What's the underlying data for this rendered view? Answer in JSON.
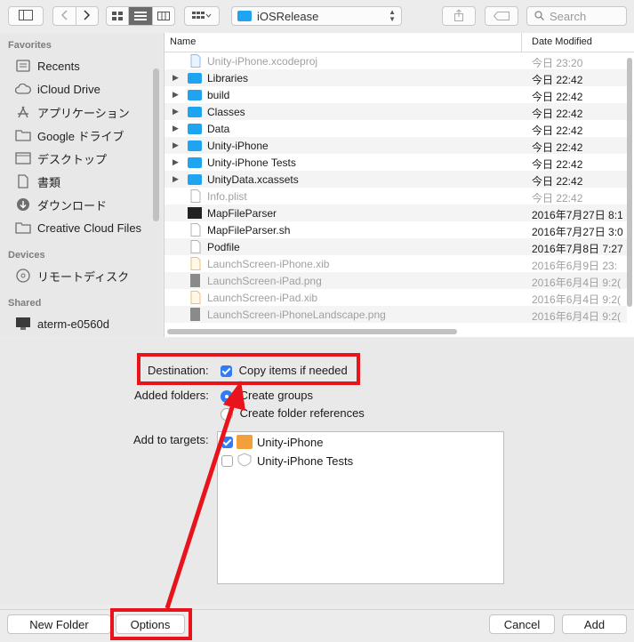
{
  "toolbar": {
    "location": "iOSRelease",
    "search_placeholder": "Search",
    "icons": [
      "sidebar-toggle-icon",
      "back-icon",
      "forward-icon",
      "icon-view-icon",
      "list-view-icon",
      "column-view-icon",
      "group-icon",
      "share-icon",
      "tag-icon",
      "search-icon"
    ]
  },
  "sidebar": {
    "favorites_header": "Favorites",
    "favorites": [
      {
        "label": "Recents",
        "icon": "recents-icon"
      },
      {
        "label": "iCloud Drive",
        "icon": "cloud-icon"
      },
      {
        "label": "アプリケーション",
        "icon": "applications-icon"
      },
      {
        "label": "Google ドライブ",
        "icon": "folder-icon"
      },
      {
        "label": "デスクトップ",
        "icon": "desktop-icon"
      },
      {
        "label": "書類",
        "icon": "document-icon"
      },
      {
        "label": "ダウンロード",
        "icon": "download-icon"
      },
      {
        "label": "Creative Cloud Files",
        "icon": "folder-icon"
      }
    ],
    "devices_header": "Devices",
    "devices": [
      {
        "label": "リモートディスク",
        "icon": "disc-icon"
      }
    ],
    "shared_header": "Shared",
    "shared": [
      {
        "label": "aterm-e0560d",
        "icon": "computer-icon"
      }
    ]
  },
  "browser": {
    "col_name": "Name",
    "col_date": "Date Modified",
    "rows": [
      {
        "name": "Unity-iPhone.xcodeproj",
        "date": "今日 23:20",
        "kind": "xcodeproj",
        "dim": true
      },
      {
        "name": "Libraries",
        "date": "今日 22:42",
        "kind": "folder",
        "dim": false
      },
      {
        "name": "build",
        "date": "今日 22:42",
        "kind": "folder",
        "dim": false
      },
      {
        "name": "Classes",
        "date": "今日 22:42",
        "kind": "folder",
        "dim": false
      },
      {
        "name": "Data",
        "date": "今日 22:42",
        "kind": "folder",
        "dim": false
      },
      {
        "name": "Unity-iPhone",
        "date": "今日 22:42",
        "kind": "folder",
        "dim": false
      },
      {
        "name": "Unity-iPhone Tests",
        "date": "今日 22:42",
        "kind": "folder",
        "dim": false
      },
      {
        "name": "UnityData.xcassets",
        "date": "今日 22:42",
        "kind": "folder",
        "dim": false
      },
      {
        "name": "Info.plist",
        "date": "今日 22:42",
        "kind": "file",
        "dim": true
      },
      {
        "name": "MapFileParser",
        "date": "2016年7月27日 8:1",
        "kind": "exec",
        "dim": false
      },
      {
        "name": "MapFileParser.sh",
        "date": "2016年7月27日 3:0",
        "kind": "file",
        "dim": false
      },
      {
        "name": "Podfile",
        "date": "2016年7月8日 7:27",
        "kind": "file",
        "dim": false
      },
      {
        "name": "LaunchScreen-iPhone.xib",
        "date": "2016年6月9日 23:",
        "kind": "xib",
        "dim": true
      },
      {
        "name": "LaunchScreen-iPad.png",
        "date": "2016年6月4日 9:2(",
        "kind": "png",
        "dim": true
      },
      {
        "name": "LaunchScreen-iPad.xib",
        "date": "2016年6月4日 9:2(",
        "kind": "xib",
        "dim": true
      },
      {
        "name": "LaunchScreen-iPhoneLandscape.png",
        "date": "2016年6月4日 9:2(",
        "kind": "png",
        "dim": true
      }
    ]
  },
  "options": {
    "destination_label": "Destination:",
    "copy_items_label": "Copy items if needed",
    "copy_items_checked": true,
    "added_folders_label": "Added folders:",
    "create_groups_label": "Create groups",
    "create_folder_refs_label": "Create folder references",
    "selected_folder_option": "Create groups",
    "add_to_targets_label": "Add to targets:",
    "targets": [
      {
        "name": "Unity-iPhone",
        "checked": true
      },
      {
        "name": "Unity-iPhone Tests",
        "checked": false
      }
    ]
  },
  "buttons": {
    "new_folder": "New Folder",
    "options": "Options",
    "cancel": "Cancel",
    "add": "Add"
  },
  "colors": {
    "accent": "#2f7cf6",
    "folder": "#1fa5ef",
    "annotation": "#e8131b"
  }
}
